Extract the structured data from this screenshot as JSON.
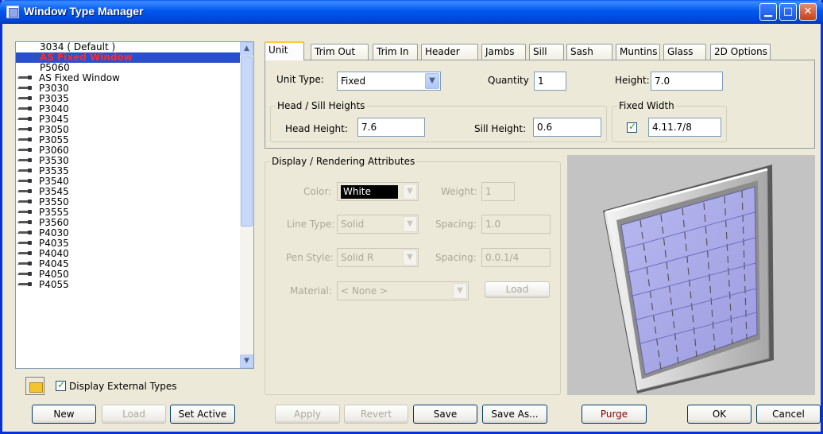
{
  "window": {
    "title": "Window Type Manager"
  },
  "type_list": {
    "items": [
      {
        "label": "3034 ( Default )",
        "kind": "plain"
      },
      {
        "label": "AS Fixed Window",
        "kind": "selected"
      },
      {
        "label": "P5060",
        "kind": "plain"
      },
      {
        "label": "AS Fixed Window",
        "kind": "external"
      },
      {
        "label": "P3030",
        "kind": "external"
      },
      {
        "label": "P3035",
        "kind": "external"
      },
      {
        "label": "P3040",
        "kind": "external"
      },
      {
        "label": "P3045",
        "kind": "external"
      },
      {
        "label": "P3050",
        "kind": "external"
      },
      {
        "label": "P3055",
        "kind": "external"
      },
      {
        "label": "P3060",
        "kind": "external"
      },
      {
        "label": "P3530",
        "kind": "external"
      },
      {
        "label": "P3535",
        "kind": "external"
      },
      {
        "label": "P3540",
        "kind": "external"
      },
      {
        "label": "P3545",
        "kind": "external"
      },
      {
        "label": "P3550",
        "kind": "external"
      },
      {
        "label": "P3555",
        "kind": "external"
      },
      {
        "label": "P3560",
        "kind": "external"
      },
      {
        "label": "P4030",
        "kind": "external"
      },
      {
        "label": "P4035",
        "kind": "external"
      },
      {
        "label": "P4040",
        "kind": "external"
      },
      {
        "label": "P4045",
        "kind": "external"
      },
      {
        "label": "P4050",
        "kind": "external"
      },
      {
        "label": "P4055",
        "kind": "external"
      }
    ],
    "display_external_label": "Display External Types",
    "display_external_checked": true
  },
  "left_buttons": {
    "new": "New",
    "load": "Load",
    "set_active": "Set Active"
  },
  "tabs": [
    "Unit",
    "Trim Out",
    "Trim In",
    "Header",
    "Jambs",
    "Sill",
    "Sash",
    "Muntins",
    "Glass",
    "2D Options"
  ],
  "unit": {
    "unit_type_label": "Unit Type:",
    "unit_type_value": "Fixed",
    "quantity_label": "Quantity",
    "quantity_value": "1",
    "height_label": "Height:",
    "height_value": "7.0",
    "head_sill_group": "Head / Sill Heights",
    "head_height_label": "Head Height:",
    "head_height_value": "7.6",
    "sill_height_label": "Sill Height:",
    "sill_height_value": "0.6",
    "fixed_width_group": "Fixed Width",
    "fixed_width_checked": true,
    "fixed_width_value": "4.11.7/8"
  },
  "display_attributes": {
    "group_title": "Display / Rendering Attributes",
    "color_label": "Color:",
    "color_value": "White",
    "weight_label": "Weight:",
    "weight_value": "1",
    "line_type_label": "Line Type:",
    "line_type_value": "Solid",
    "spacing_label": "Spacing:",
    "spacing_value": "1.0",
    "pen_style_label": "Pen Style:",
    "pen_style_value": "Solid R",
    "spacing2_label": "Spacing:",
    "spacing2_value": "0.0.1/4",
    "material_label": "Material:",
    "material_value": "< None >",
    "load_label": "Load"
  },
  "bottom_buttons": {
    "apply": "Apply",
    "revert": "Revert",
    "save": "Save",
    "save_as": "Save As...",
    "purge": "Purge",
    "ok": "OK",
    "cancel": "Cancel"
  },
  "colors": {
    "titlebar": "#0058EE",
    "selection": "#2A4FCB",
    "selected_text": "#FF2A2A"
  }
}
